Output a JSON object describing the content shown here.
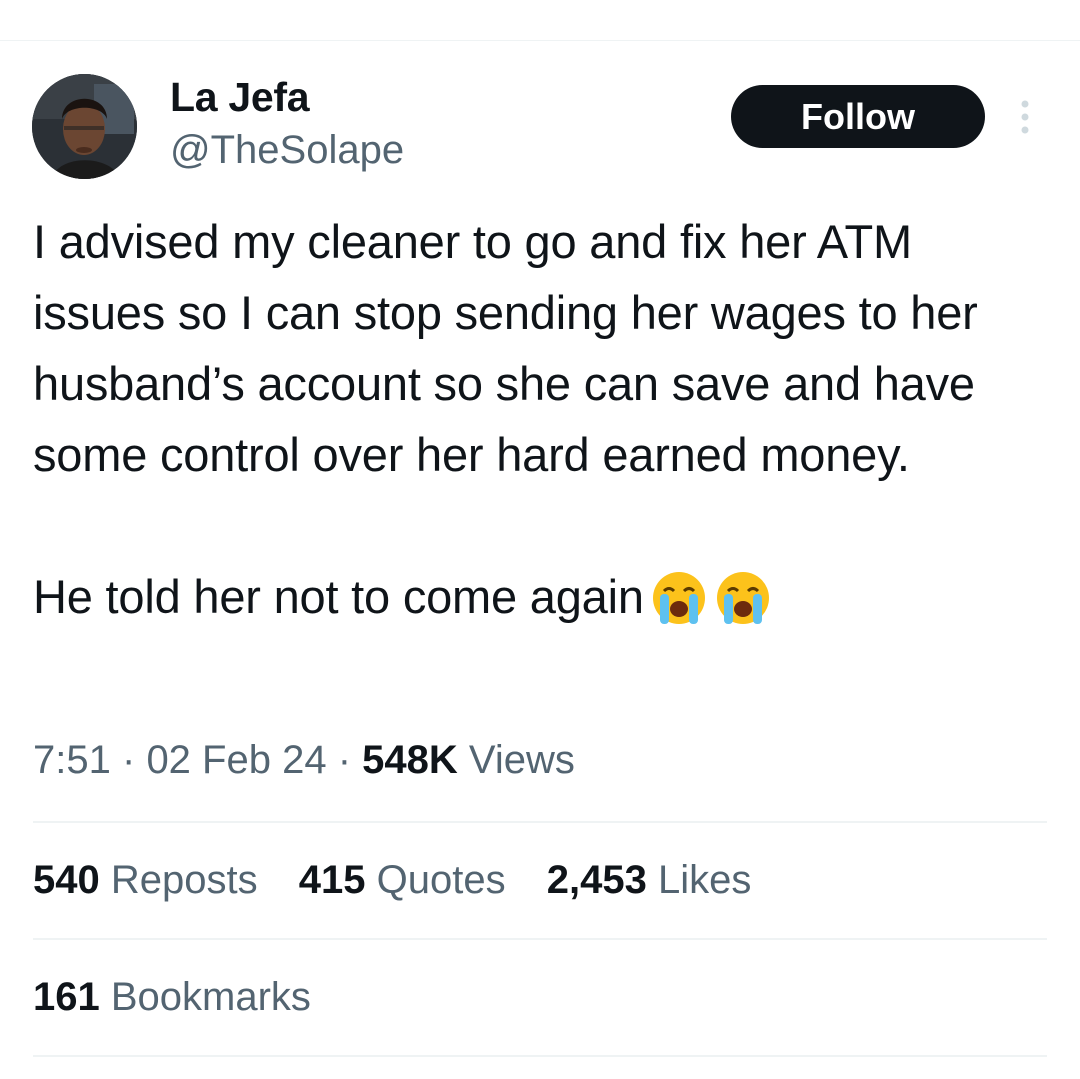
{
  "author": {
    "name": "La Jefa",
    "handle": "@TheSolape",
    "follow_label": "Follow"
  },
  "tweet": {
    "paragraph1": "I advised my cleaner to go and fix her ATM issues so I can stop sending her wages to her husband’s account so she can save and have some control over her hard earned money.",
    "paragraph2": "He told her not to come again",
    "emojis": [
      "loudly-crying-face",
      "loudly-crying-face"
    ]
  },
  "meta": {
    "time": "7:51",
    "separator": "·",
    "date": "02 Feb 24",
    "views_count": "548K",
    "views_label": "Views"
  },
  "stats": {
    "reposts_count": "540",
    "reposts_label": "Reposts",
    "quotes_count": "415",
    "quotes_label": "Quotes",
    "likes_count": "2,453",
    "likes_label": "Likes",
    "bookmarks_count": "161",
    "bookmarks_label": "Bookmarks"
  },
  "colors": {
    "text": "#0f1419",
    "secondary": "#536471",
    "divider": "#eff3f4",
    "button_bg": "#0f1419"
  }
}
